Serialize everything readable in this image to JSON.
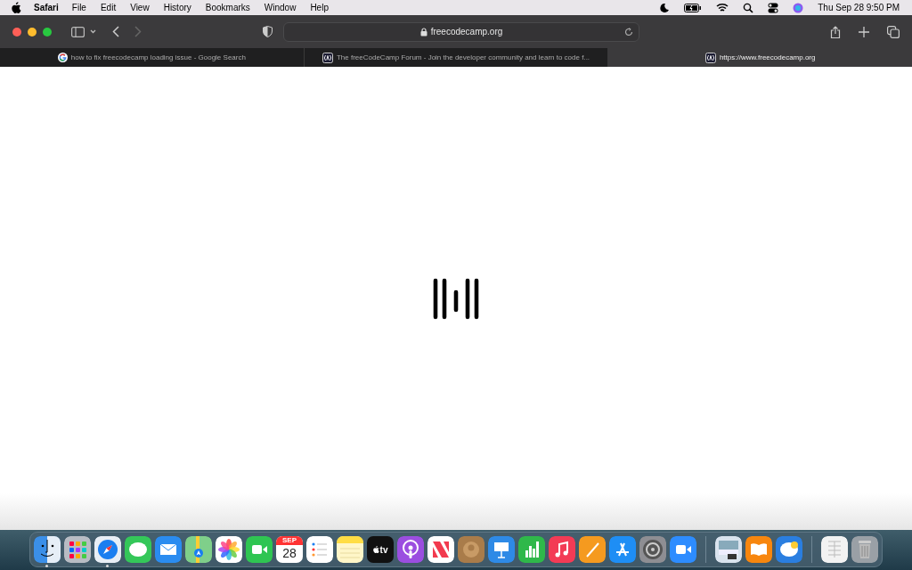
{
  "menu_bar": {
    "app_name": "Safari",
    "menus": [
      "File",
      "Edit",
      "View",
      "History",
      "Bookmarks",
      "Window",
      "Help"
    ],
    "clock": "Thu Sep 28  9:50 PM"
  },
  "toolbar": {
    "address": "freecodecamp.org"
  },
  "tabs": [
    {
      "title": "how to fix freecodecamp loading issue - Google Search",
      "selected": false
    },
    {
      "title": "The freeCodeCamp Forum - Join the developer community and learn to code f...",
      "selected": false
    },
    {
      "title": "https://www.freecodecamp.org",
      "selected": true
    }
  ],
  "dock": [
    {
      "kind": "finder",
      "running": true
    },
    {
      "kind": "launchpad",
      "running": false
    },
    {
      "kind": "safari",
      "running": true
    },
    {
      "kind": "messages",
      "running": false
    },
    {
      "kind": "mail",
      "running": false
    },
    {
      "kind": "maps",
      "running": false
    },
    {
      "kind": "photos",
      "running": false
    },
    {
      "kind": "facetime",
      "running": false
    },
    {
      "kind": "calendar",
      "running": false,
      "month": "SEP",
      "day": "28"
    },
    {
      "kind": "reminders",
      "running": false
    },
    {
      "kind": "notes",
      "running": false
    },
    {
      "kind": "tv",
      "running": false,
      "label": "tv"
    },
    {
      "kind": "podcasts",
      "running": false
    },
    {
      "kind": "news",
      "running": false
    },
    {
      "kind": "contacts",
      "running": false
    },
    {
      "kind": "keynote",
      "running": false
    },
    {
      "kind": "numbers",
      "running": false
    },
    {
      "kind": "music",
      "running": false
    },
    {
      "kind": "pages",
      "running": false
    },
    {
      "kind": "appstore",
      "running": false
    },
    {
      "kind": "settings",
      "running": false
    },
    {
      "kind": "zoom",
      "running": false
    },
    {
      "kind": "separator"
    },
    {
      "kind": "preview",
      "running": false
    },
    {
      "kind": "books",
      "running": false
    },
    {
      "kind": "weather",
      "running": false
    },
    {
      "kind": "separator"
    },
    {
      "kind": "document",
      "running": false
    },
    {
      "kind": "trash",
      "running": false
    }
  ]
}
